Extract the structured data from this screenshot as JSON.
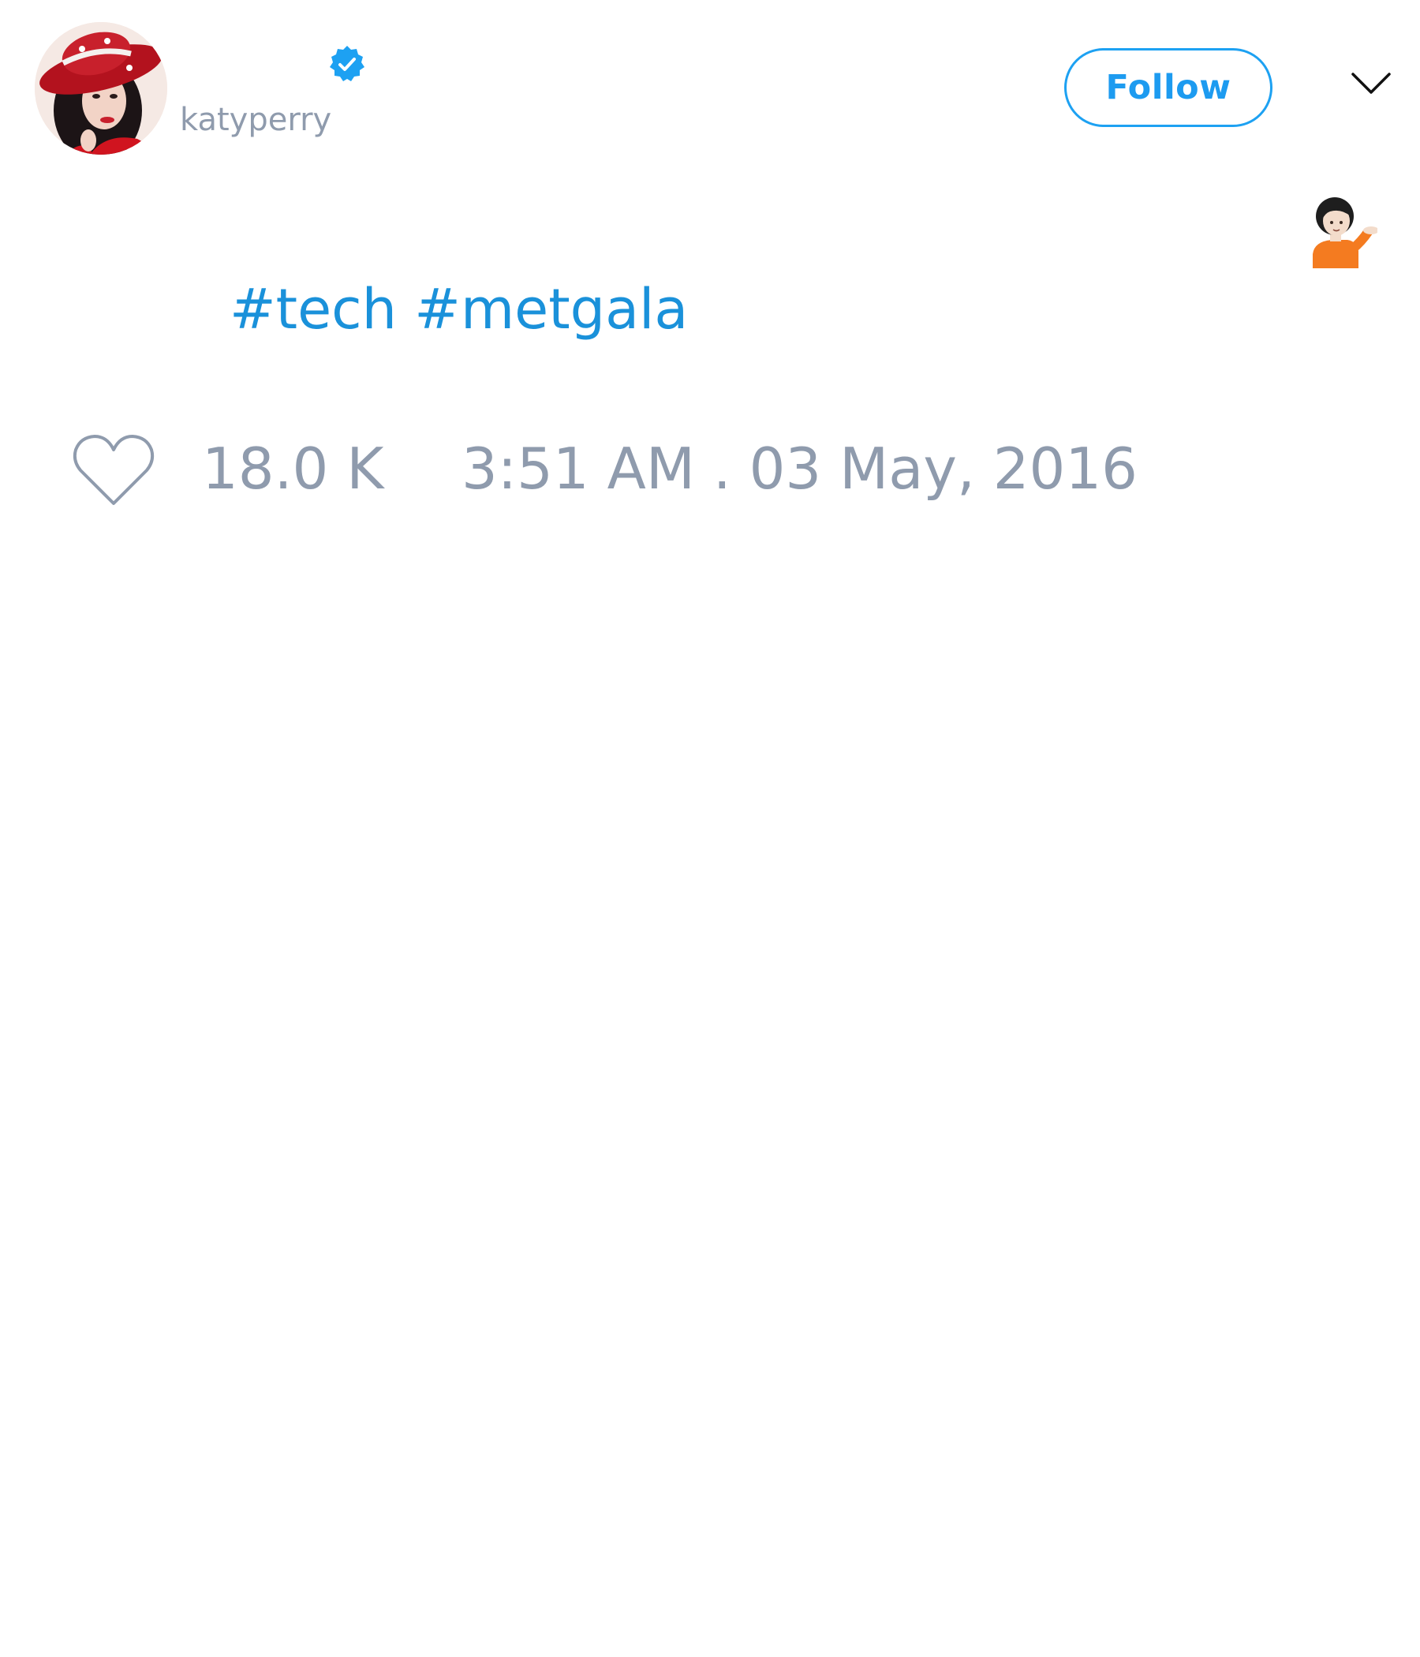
{
  "user": {
    "handle": "katyperry",
    "verified": true,
    "avatar_icon": "profile-photo-red-hat"
  },
  "header": {
    "follow_label": "Follow",
    "menu_icon": "chevron-down-icon"
  },
  "tweet": {
    "emoji": "💁🏻",
    "hashtags": [
      "#tech",
      "#metgala"
    ]
  },
  "footer": {
    "like_icon": "heart-icon",
    "like_count": "18.0 K",
    "timestamp": "3:51 AM . 03 May, 2016"
  },
  "colors": {
    "accent": "#1DA1F2",
    "link": "#1A91DA",
    "muted": "#8F9BAD",
    "background": "#FFFFFF"
  }
}
